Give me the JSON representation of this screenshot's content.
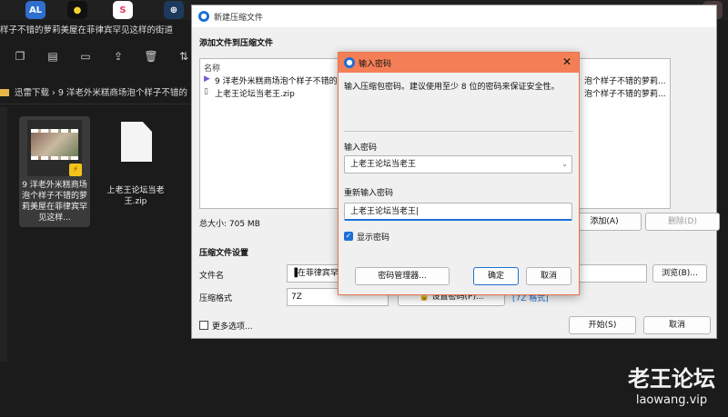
{
  "taskbar": {
    "app1": "AL",
    "app2": "●",
    "app3": "S",
    "app4": "⊕"
  },
  "explorer": {
    "title": "样子不错的萝莉美屋在菲律宾罕见这样的街道",
    "breadcrumb": "迅雷下载  ›  9 洋老外米糕商场泡个样子不错的",
    "files": [
      {
        "name": "9 洋老外米糕商场泡个样子不错的萝莉美屋在菲律宾罕见这样..."
      },
      {
        "name": "上老王论坛当老王.zip"
      }
    ]
  },
  "dialog": {
    "title": "新建压缩文件",
    "section_files": "添加文件到压缩文件",
    "col_name": "名称",
    "files": [
      {
        "name": "9 洋老外米糕商场泡个样子不错的",
        "right": "泡个样子不错的萝莉..."
      },
      {
        "name": "上老王论坛当老王.zip",
        "right": "泡个样子不错的萝莉..."
      }
    ],
    "total_size": "总大小: 705 MB",
    "add_btn": "添加(A)",
    "delete_btn": "删除(D)",
    "section_settings": "压缩文件设置",
    "filename_label": "文件名",
    "filename_value": "▐在菲律宾罕见",
    "browse_btn": "浏览(B)...",
    "format_label": "压缩格式",
    "format_value": "7Z",
    "set_password_btn": "设置密码(P)...",
    "format_link": "[7Z 格式]",
    "more_options": "更多选项...",
    "start_btn": "开始(S)",
    "cancel_btn": "取消"
  },
  "password_dialog": {
    "title": "输入密码",
    "hint": "输入压缩包密码。建议使用至少 8 位的密码来保证安全性。",
    "enter_label": "输入密码",
    "enter_value": "上老王论坛当老王",
    "reenter_label": "重新输入密码",
    "reenter_value": "上老王论坛当老王",
    "show_password": "显示密码",
    "manager_btn": "密码管理器...",
    "ok_btn": "确定",
    "cancel_btn": "取消"
  },
  "watermark": {
    "line1": "老王论坛",
    "line2": "laowang.vip"
  },
  "colors": {
    "password_title": "#f47f56",
    "accent": "#1c6fd6",
    "dialog_bg": "#f0f0f0",
    "explorer_bg": "#1b1b1b"
  }
}
